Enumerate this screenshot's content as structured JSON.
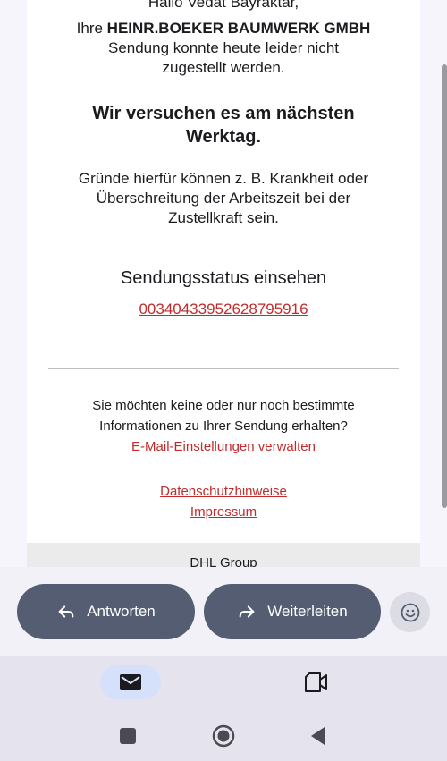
{
  "email": {
    "greeting": "Hallo Vedat Bayraktar,",
    "notice_prefix": "Ihre ",
    "sender_company": "HEINR.BOEKER BAUMWERK GMBH",
    "notice_line2": "Sendung konnte heute leider nicht",
    "notice_line3": "zugestellt werden.",
    "heading_line1": "Wir versuchen es am nächsten",
    "heading_line2": "Werktag.",
    "reasons_line1": "Gründe hierfür können z. B. Krankheit oder",
    "reasons_line2": "Überschreitung der Arbeitszeit bei der",
    "reasons_line3": "Zustellkraft sein.",
    "status_title": "Sendungsstatus einsehen",
    "tracking_number": "00340433952628795916",
    "prefs_line1": "Sie möchten keine oder nur noch bestimmte",
    "prefs_line2": "Informationen zu Ihrer Sendung erhalten?",
    "prefs_link": "E-Mail-Einstellungen verwalten",
    "privacy_link": "Datenschutzhinweise",
    "imprint_link": "Impressum",
    "footer_company": "DHL Group"
  },
  "actions": {
    "reply_label": "Antworten",
    "forward_label": "Weiterleiten"
  },
  "icons": {
    "reply": "reply-arrow-icon",
    "forward": "forward-arrow-icon",
    "emoji": "smiley-icon",
    "mail": "mail-icon",
    "meet": "video-camera-icon",
    "recents": "square-icon",
    "home": "circle-icon",
    "back": "triangle-back-icon"
  },
  "colors": {
    "link": "#c22b2b",
    "pill": "#545d72",
    "nav_active": "#d5e1fa"
  }
}
